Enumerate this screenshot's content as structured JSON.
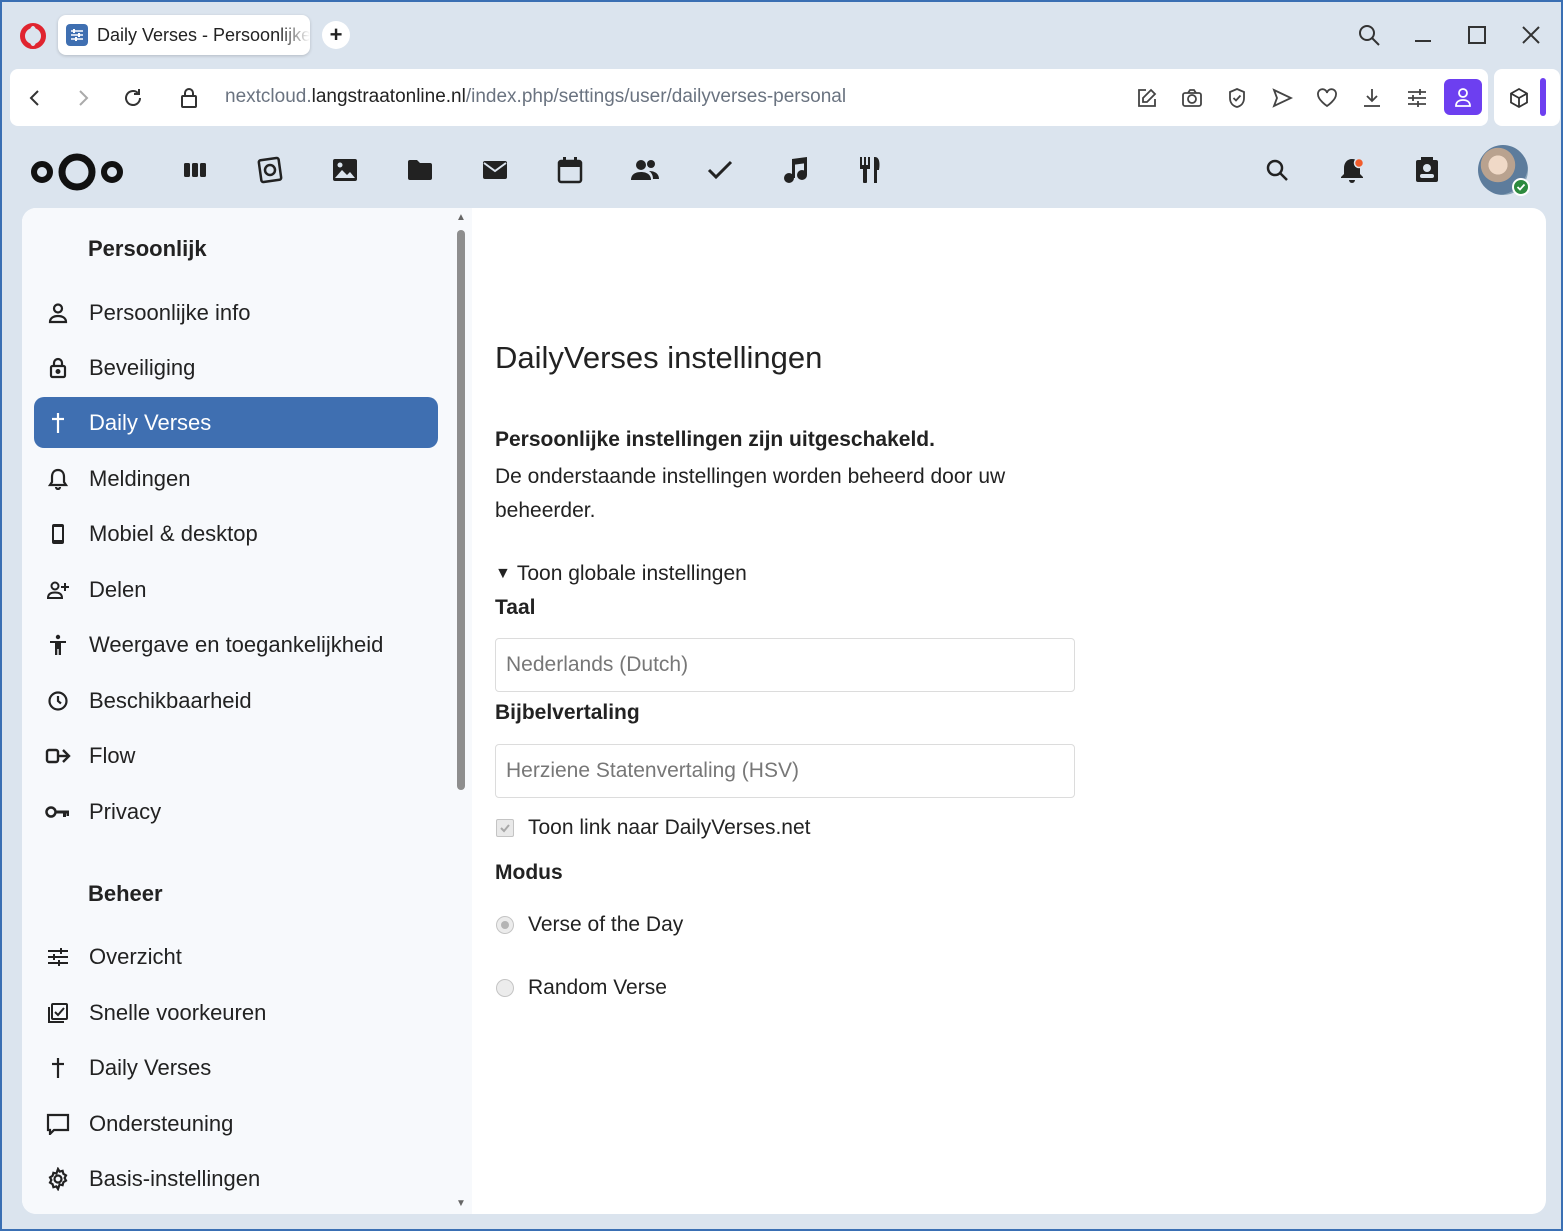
{
  "browser": {
    "tab_title": "Daily Verses - Persoonlijke instellingen",
    "url_prefix": "nextcloud.",
    "url_host": "langstraatonline.nl",
    "url_path": "/index.php/settings/user/dailyverses-personal"
  },
  "sidebar": {
    "personal_heading": "Persoonlijk",
    "personal_items": [
      {
        "label": "Persoonlijke info",
        "icon": "user-icon"
      },
      {
        "label": "Beveiliging",
        "icon": "lock-icon"
      },
      {
        "label": "Daily Verses",
        "icon": "cross-icon",
        "active": true
      },
      {
        "label": "Meldingen",
        "icon": "bell-icon"
      },
      {
        "label": "Mobiel & desktop",
        "icon": "phone-icon"
      },
      {
        "label": "Delen",
        "icon": "share-user-icon"
      },
      {
        "label": "Weergave en toegankelijkheid",
        "icon": "accessibility-icon"
      },
      {
        "label": "Beschikbaarheid",
        "icon": "clock-icon"
      },
      {
        "label": "Flow",
        "icon": "flow-icon"
      },
      {
        "label": "Privacy",
        "icon": "key-icon"
      }
    ],
    "admin_heading": "Beheer",
    "admin_items": [
      {
        "label": "Overzicht",
        "icon": "tune-icon"
      },
      {
        "label": "Snelle voorkeuren",
        "icon": "checklist-icon"
      },
      {
        "label": "Daily Verses",
        "icon": "cross-icon"
      },
      {
        "label": "Ondersteuning",
        "icon": "chat-icon"
      },
      {
        "label": "Basis-instellingen",
        "icon": "gear-icon"
      }
    ]
  },
  "main": {
    "title": "DailyVerses instellingen",
    "notice_strong": "Persoonlijke instellingen zijn uitgeschakeld.",
    "notice_text": "De onderstaande instellingen worden beheerd door uw beheerder.",
    "details_summary": "Toon globale instellingen",
    "language_label": "Taal",
    "language_value": "Nederlands (Dutch)",
    "translation_label": "Bijbelvertaling",
    "translation_value": "Herziene Statenvertaling (HSV)",
    "show_link_label": "Toon link naar DailyVerses.net",
    "show_link_checked": true,
    "mode_label": "Modus",
    "mode_options": [
      "Verse of the Day",
      "Random Verse"
    ],
    "mode_selected": "Verse of the Day"
  },
  "colors": {
    "accent": "#3f6fb1",
    "window_border": "#3a6fb3",
    "header_bg": "#dbe4ee",
    "profile_button": "#6d3ff0",
    "notification_dot": "#f25c2c",
    "status_online": "#2d8a3e"
  }
}
